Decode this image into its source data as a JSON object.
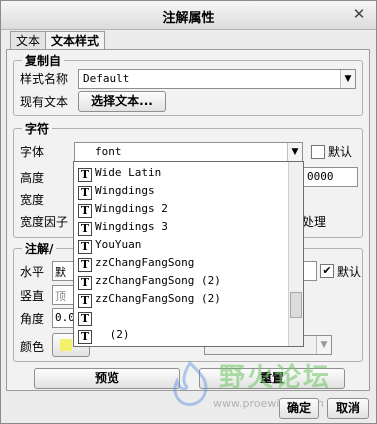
{
  "window": {
    "title": "注解属性"
  },
  "tabs": [
    {
      "label": "文本"
    },
    {
      "label": "文本样式"
    }
  ],
  "copy_from": {
    "title": "复制自",
    "style_name_label": "样式名称",
    "style_name_value": "Default",
    "existing_text_label": "现有文本",
    "select_text_button": "选择文本..."
  },
  "character": {
    "title": "字符",
    "font_label": "字体",
    "font_value": "font",
    "default_label": "默认",
    "height_label": "高度",
    "height_value": "0000",
    "width_label": "宽度",
    "width_factor_label": "宽度因子",
    "processing_label": "处理"
  },
  "font_dropdown": {
    "items": [
      "Wide Latin",
      "Wingdings",
      "Wingdings 2",
      "Wingdings 3",
      "YouYuan",
      "zzChangFangSong",
      "zzChangFangSong (2)",
      "zzChangFangSong (2)",
      "",
      " (2)"
    ]
  },
  "note": {
    "title": "注解/",
    "horizontal_label": "水平",
    "horizontal_value": "默认",
    "vertical_label": "竖直",
    "vertical_value": "顶部",
    "angle_label": "角度",
    "angle_value": "0.0",
    "color_label": "颜色",
    "color_swatch": "#f3f06a",
    "default_label": "默认"
  },
  "buttons": {
    "preview": "预览",
    "reset": "重置",
    "ok": "确定",
    "cancel": "取消"
  },
  "watermark": {
    "text": "野火论坛",
    "url": "www.proewildfire.cn"
  }
}
